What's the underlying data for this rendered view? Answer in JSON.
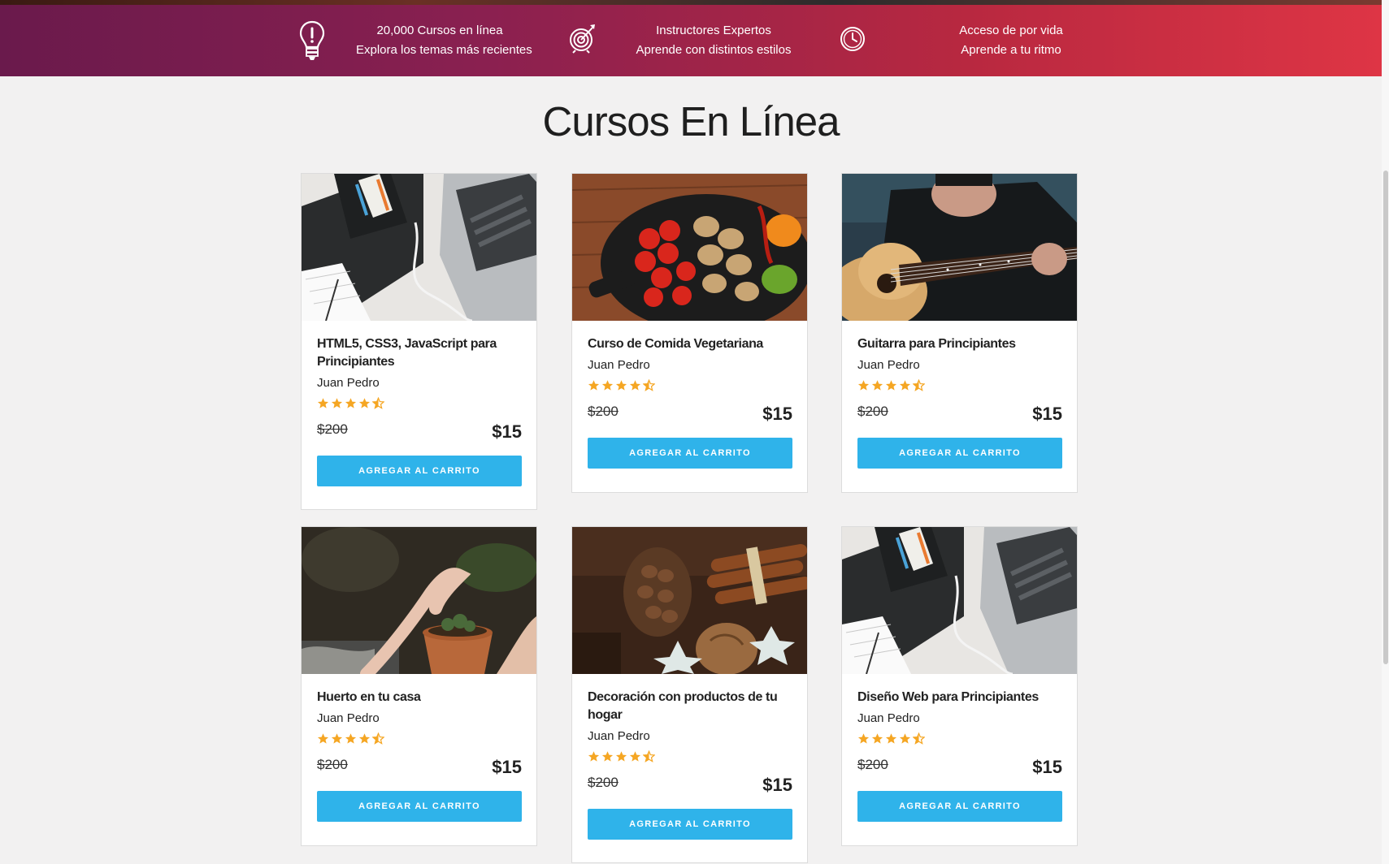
{
  "banner": {
    "features": [
      {
        "icon": "lightbulb-icon",
        "line1": "20,000 Cursos en línea",
        "line2": "Explora los temas más recientes"
      },
      {
        "icon": "target-icon",
        "line1": "Instructores Expertos",
        "line2": "Aprende con distintos estilos"
      },
      {
        "icon": "clock-icon",
        "line1": "Acceso de por vida",
        "line2": "Aprende a tu ritmo"
      }
    ]
  },
  "page": {
    "title": "Cursos En Línea"
  },
  "courses": [
    {
      "title": "HTML5, CSS3, JavaScript para Principiantes",
      "author": "Juan Pedro",
      "rating": 4.5,
      "old_price": "$200",
      "price": "$15",
      "button": "AGREGAR AL CARRITO",
      "image": "laptop-book-image"
    },
    {
      "title": "Curso de Comida Vegetariana",
      "author": "Juan Pedro",
      "rating": 4.5,
      "old_price": "$200",
      "price": "$15",
      "button": "AGREGAR AL CARRITO",
      "image": "vegetables-pan-image"
    },
    {
      "title": "Guitarra para Principiantes",
      "author": "Juan Pedro",
      "rating": 4.5,
      "old_price": "$200",
      "price": "$15",
      "button": "AGREGAR AL CARRITO",
      "image": "guitar-player-image"
    },
    {
      "title": "Huerto en tu casa",
      "author": "Juan Pedro",
      "rating": 4.5,
      "old_price": "$200",
      "price": "$15",
      "button": "AGREGAR AL CARRITO",
      "image": "potted-plant-image"
    },
    {
      "title": "Decoración con productos de tu hogar",
      "author": "Juan Pedro",
      "rating": 4.5,
      "old_price": "$200",
      "price": "$15",
      "button": "AGREGAR AL CARRITO",
      "image": "cinnamon-pinecone-image"
    },
    {
      "title": "Diseño Web para Principiantes",
      "author": "Juan Pedro",
      "rating": 4.5,
      "old_price": "$200",
      "price": "$15",
      "button": "AGREGAR AL CARRITO",
      "image": "laptop-book-image"
    }
  ],
  "colors": {
    "button": "#2fb3ea",
    "star": "#f5a623",
    "banner_start": "#6a1a4c",
    "banner_end": "#de3545"
  }
}
